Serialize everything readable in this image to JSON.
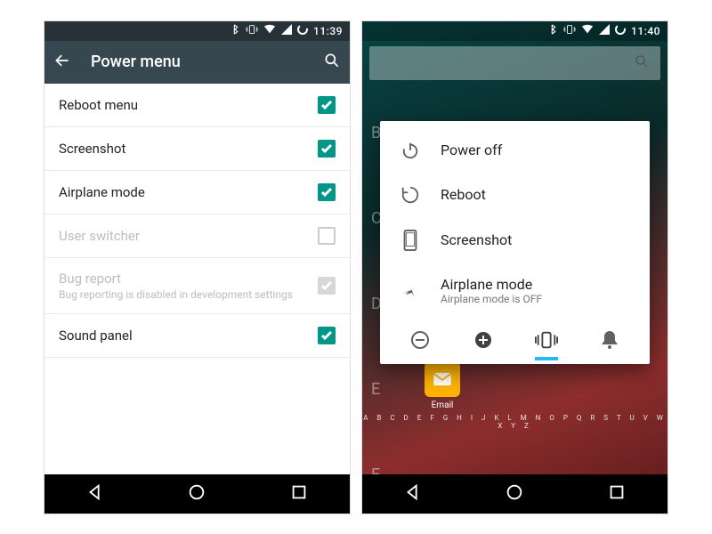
{
  "left": {
    "status_time": "11:39",
    "toolbar": {
      "title": "Power menu"
    },
    "settings": [
      {
        "label": "Reboot menu",
        "checked": true,
        "disabled": false
      },
      {
        "label": "Screenshot",
        "checked": true,
        "disabled": false
      },
      {
        "label": "Airplane mode",
        "checked": true,
        "disabled": false
      },
      {
        "label": "User switcher",
        "checked": false,
        "disabled": true
      },
      {
        "label": "Bug report",
        "sublabel": "Bug reporting is disabled in development settings",
        "checked": true,
        "disabled": true
      },
      {
        "label": "Sound panel",
        "checked": true,
        "disabled": false
      }
    ]
  },
  "right": {
    "status_time": "11:40",
    "power_menu": {
      "items": [
        {
          "icon": "power-icon",
          "label": "Power off"
        },
        {
          "icon": "reboot-icon",
          "label": "Reboot"
        },
        {
          "icon": "screenshot-icon",
          "label": "Screenshot"
        },
        {
          "icon": "airplane-icon",
          "label": "Airplane mode",
          "sublabel": "Airplane mode is OFF"
        }
      ],
      "sound_modes": [
        "silent",
        "dnd",
        "vibrate",
        "ring"
      ],
      "selected_sound_mode": "vibrate"
    },
    "alphabet_strip": "A B C D E F G H I J K L M N O P Q R S T U V W X Y Z",
    "email_label": "Email",
    "bg_letters": [
      "B",
      "C",
      "D",
      "E",
      "F"
    ]
  }
}
